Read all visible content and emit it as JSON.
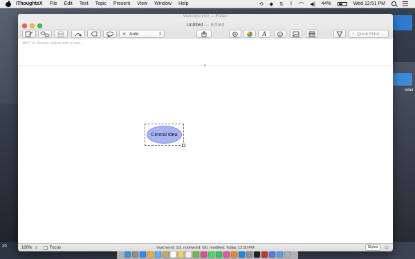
{
  "menubar": {
    "app_name": "iThoughtsX",
    "items": [
      "File",
      "Edit",
      "Text",
      "Topic",
      "Present",
      "View",
      "Window",
      "Help"
    ],
    "battery": "44%",
    "clock": "Wed 12:51 PM"
  },
  "background_window": {
    "title": "Welcome.itmz — Edited"
  },
  "window": {
    "title": "Untitled",
    "title_suffix": "— Edited"
  },
  "toolbar": {
    "layout_select": "Auto",
    "search_placeholder": "Quick Filter"
  },
  "notes": {
    "hint": "⌘RT or Double-click to add a note..."
  },
  "canvas": {
    "central_topic": "Central Idea"
  },
  "statusbar": {
    "zoom": "100%",
    "focus_label": "Focus",
    "status_text": "topic/word: 1/2, note/word: 0/0, modified: Today, 12:50 PM",
    "styles_label": "Styles"
  },
  "desktop": {
    "edge_label": "20",
    "icon_label_right": "older"
  },
  "colors": {
    "topic_fill": "#a9b3f3",
    "topic_border": "#8590e0"
  },
  "dock_icons": [
    "finder",
    "launchpad",
    "safari",
    "chrome",
    "mail",
    "contacts",
    "calendar",
    "notes",
    "reminders",
    "maps",
    "photos",
    "messages",
    "facetime",
    "itunes",
    "ibooks",
    "app-store",
    "preferences",
    "terminal",
    "acrobat",
    "ithoughts",
    "folder",
    "trash"
  ]
}
